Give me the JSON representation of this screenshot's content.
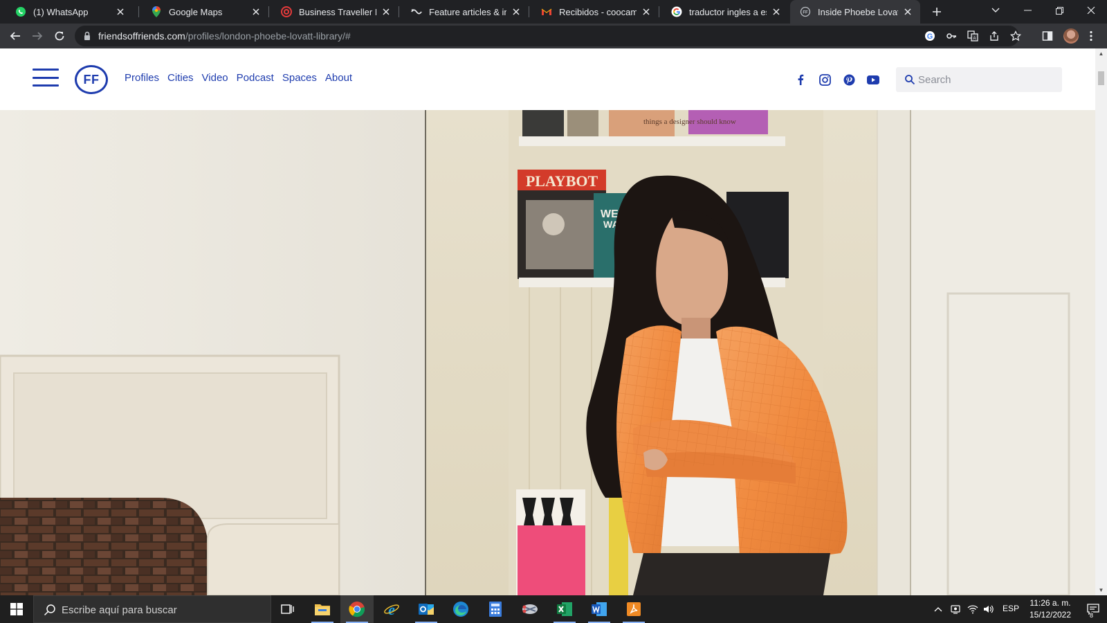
{
  "browser": {
    "tabs": [
      {
        "title": "(1) WhatsApp",
        "icon": "whatsapp-icon",
        "active": false
      },
      {
        "title": "Google Maps",
        "icon": "google-maps-icon",
        "active": false
      },
      {
        "title": "Business Traveller Midd",
        "icon": "business-traveller-icon",
        "active": false
      },
      {
        "title": "Feature articles & interv",
        "icon": "feature-articles-icon",
        "active": false
      },
      {
        "title": "Recibidos - coocampog",
        "icon": "gmail-icon",
        "active": false
      },
      {
        "title": "traductor ingles a espar",
        "icon": "google-icon",
        "active": false
      },
      {
        "title": "Inside Phoebe Lovatt's",
        "icon": "friends-of-friends-icon",
        "active": true
      }
    ],
    "address": {
      "host": "friendsoffriends.com",
      "path": "/profiles/london-phoebe-lovatt-library/#"
    }
  },
  "site": {
    "logo_text": "FF",
    "nav": [
      "Profiles",
      "Cities",
      "Video",
      "Podcast",
      "Spaces",
      "About"
    ],
    "social": [
      "facebook-icon",
      "instagram-icon",
      "pinterest-icon",
      "youtube-icon"
    ],
    "search_placeholder": "Search",
    "brand_color": "#1e3cae"
  },
  "hero": {
    "magazine_title": "PLAYBOT",
    "book_fragment": "WEIR",
    "book_fragment_2": "WA",
    "shelf_text": "things a designer should know"
  },
  "taskbar": {
    "search_placeholder": "Escribe aquí para buscar",
    "apps": [
      "task-view-icon",
      "file-explorer-icon",
      "chrome-icon",
      "internet-explorer-icon",
      "outlook-icon",
      "edge-icon",
      "calculator-icon",
      "snipping-tool-icon",
      "excel-icon",
      "word-icon",
      "pdf-reader-icon"
    ],
    "language": "ESP",
    "time": "11:26 a. m.",
    "date": "15/12/2022",
    "notification_count": "8"
  }
}
